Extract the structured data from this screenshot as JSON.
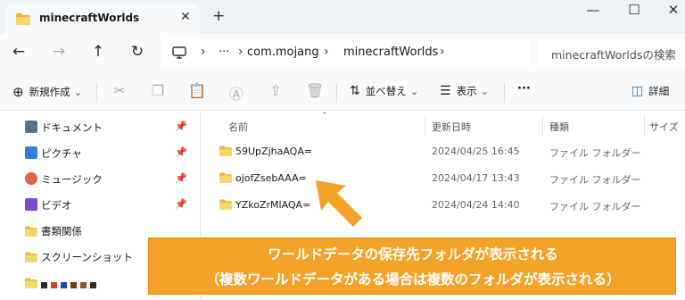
{
  "window": {
    "tab_title": "minecraftWorlds",
    "tab_close_glyph": "✕",
    "new_tab_glyph": "+",
    "minimize_glyph": "—",
    "maximize_glyph": "☐",
    "close_glyph": "✕"
  },
  "nav": {
    "back_glyph": "←",
    "forward_glyph": "→",
    "up_glyph": "↑",
    "refresh_glyph": "↻",
    "breadcrumb": {
      "sep": "›",
      "more": "···",
      "items": [
        "com.mojang",
        "minecraftWorlds"
      ]
    },
    "search_placeholder": "minecraftWorldsの検索"
  },
  "commandbar": {
    "new_label": "新規作成",
    "new_glyph": "⊕",
    "sort_label": "並べ替え",
    "sort_glyph": "⇅",
    "view_label": "表示",
    "view_glyph": "☰",
    "more_glyph": "···",
    "details_label": "詳細",
    "details_glyph": "◫",
    "cut_glyph": "✂",
    "copy_glyph": "❐",
    "paste_glyph": "📋",
    "rename_glyph": "Ⓐ",
    "share_glyph": "⇪",
    "delete_glyph": "🗑",
    "chevron": "⌄"
  },
  "sidebar": {
    "pin_glyph": "📌",
    "items": [
      {
        "label": "ドキュメント",
        "icon": "document-icon",
        "color": "#5b6e8c",
        "pinned": true
      },
      {
        "label": "ピクチャ",
        "icon": "pictures-icon",
        "color": "#2f7fd6",
        "pinned": true
      },
      {
        "label": "ミュージック",
        "icon": "music-icon",
        "color": "#e0624a",
        "pinned": true
      },
      {
        "label": "ビデオ",
        "icon": "video-icon",
        "color": "#7a4ad6",
        "pinned": true
      },
      {
        "label": "書類関係",
        "icon": "folder-icon",
        "color": "#f4c54f",
        "pinned": false
      },
      {
        "label": "スクリーンショット",
        "icon": "folder-icon",
        "color": "#f4c54f",
        "pinned": false
      },
      {
        "label": "",
        "icon": "folder-icon",
        "color": "#f4c54f",
        "pinned": false
      }
    ]
  },
  "filelist": {
    "columns": {
      "name": "名前",
      "modified": "更新日時",
      "type": "種類",
      "size": "サイズ"
    },
    "sort_caret": "⌃",
    "rows": [
      {
        "name": "59UpZjhaAQA=",
        "modified": "2024/04/25 16:45",
        "type": "ファイル フォルダー"
      },
      {
        "name": "ojofZsebAAA=",
        "modified": "2024/04/17 13:43",
        "type": "ファイル フォルダー"
      },
      {
        "name": "YZkoZrMlAQA=",
        "modified": "2024/04/24 14:40",
        "type": "ファイル フォルダー"
      }
    ]
  },
  "annotation": {
    "line1": "ワールドデータの保存先フォルダが表示される",
    "line2": "（複数ワールドデータがある場合は複数のフォルダが表示される）",
    "color": "#f5a328"
  }
}
